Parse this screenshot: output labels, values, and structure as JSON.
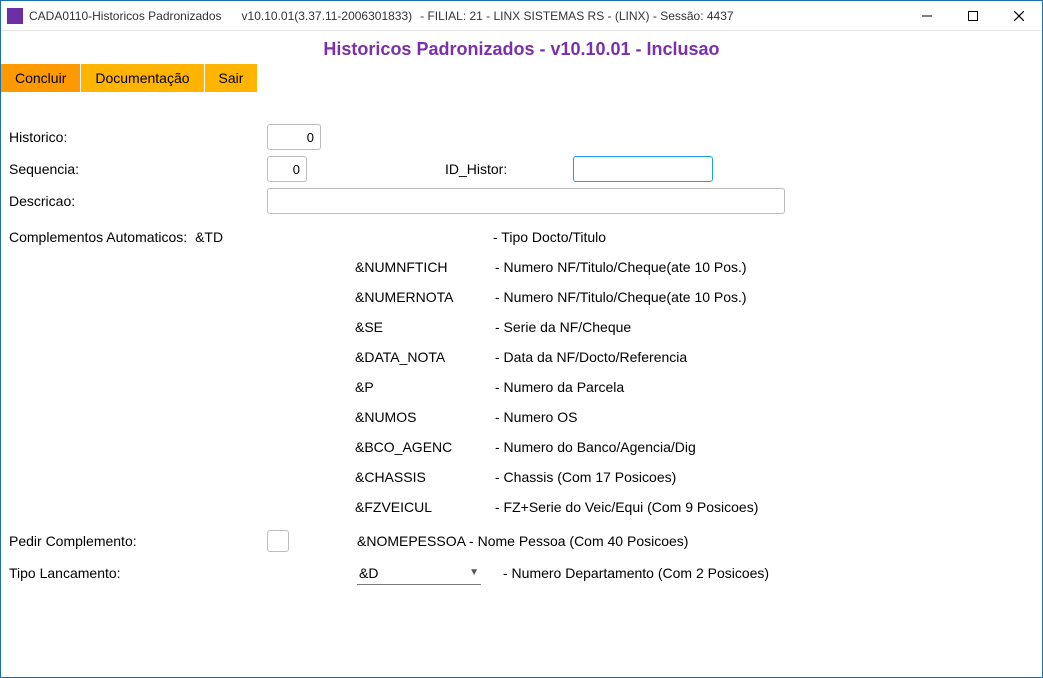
{
  "titlebar": {
    "app_name": "CADA0110-Historicos Padronizados",
    "version": "v10.10.01(3.37.11-2006301833)",
    "context": "- FILIAL: 21 - LINX SISTEMAS RS - (LINX) - Sessão: 4437"
  },
  "banner": "Historicos Padronizados               - v10.10.01 - Inclusao",
  "toolbar": {
    "concluir": "Concluir",
    "documentacao": "Documentação",
    "sair": "Sair"
  },
  "form": {
    "historico_label": "Historico:",
    "historico_value": "0",
    "sequencia_label": "Sequencia:",
    "sequencia_value": "0",
    "id_histor_label": "ID_Histor:",
    "id_histor_value": "",
    "descricao_label": "Descricao:",
    "descricao_value": "",
    "comp_auto_label": "Complementos Automaticos:",
    "comp_auto_first_code": "&TD",
    "comp_auto_first_desc": "- Tipo Docto/Titulo",
    "complements": [
      {
        "code": "&NUMNFTICH",
        "desc": "- Numero NF/Titulo/Cheque(ate 10 Pos.)"
      },
      {
        "code": "&NUMERNOTA",
        "desc": "- Numero NF/Titulo/Cheque(ate 10 Pos.)"
      },
      {
        "code": "&SE",
        "desc": "- Serie da NF/Cheque"
      },
      {
        "code": "&DATA_NOTA",
        "desc": "- Data da NF/Docto/Referencia"
      },
      {
        "code": "&P",
        "desc": "- Numero da Parcela"
      },
      {
        "code": "&NUMOS",
        "desc": "- Numero OS"
      },
      {
        "code": "&BCO_AGENC",
        "desc": "- Numero do Banco/Agencia/Dig"
      },
      {
        "code": "&CHASSIS",
        "desc": "- Chassis (Com 17 Posicoes)"
      },
      {
        "code": "&FZVEICUL",
        "desc": "- FZ+Serie do Veic/Equi (Com 9 Posicoes)"
      }
    ],
    "pedir_complemento_label": "Pedir Complemento:",
    "nomepessoa_line": "&NOMEPESSOA - Nome Pessoa (Com 40 Posicoes)",
    "tipo_lancamento_label": "Tipo Lancamento:",
    "tipo_lancamento_value": "&D",
    "tipo_lancamento_desc": "- Numero Departamento (Com 2 Posicoes)"
  }
}
